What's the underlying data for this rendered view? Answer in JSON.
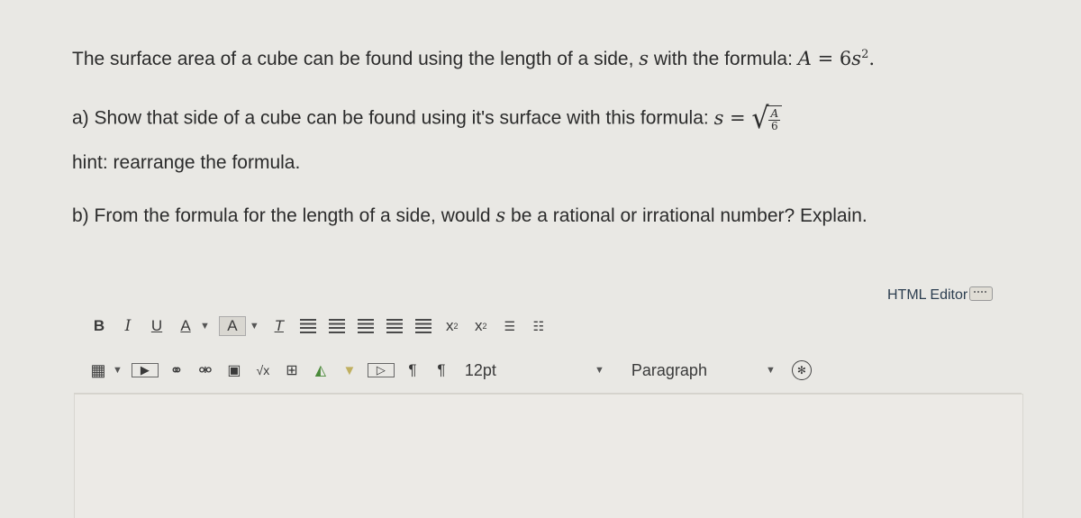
{
  "question": {
    "intro_text": "The surface area of a cube can be found using the length of a side, ",
    "intro_var": "s",
    "intro_text2": " with the formula: ",
    "formula_surface": {
      "lhs": "A",
      "eq": " = ",
      "coef": "6",
      "var": "s",
      "exp": "2",
      "end": "."
    },
    "part_a_text": "a) Show that side of a cube can be found using it's surface with this formula: ",
    "formula_side": {
      "lhs": "s",
      "eq": " = ",
      "num": "A",
      "den": "6"
    },
    "hint": "hint: rearrange the formula.",
    "part_b_pre": "b) From the formula for the length of a side, would ",
    "part_b_var": "s",
    "part_b_post": " be a rational or irrational number? Explain."
  },
  "editor": {
    "html_editor_label": "HTML Editor",
    "toolbar_row1": {
      "bold": "B",
      "italic": "I",
      "underline": "U",
      "font_color": "A",
      "bg_color": "A",
      "clear_format": "T",
      "superscript": "x",
      "superscript_mark": "2",
      "subscript": "x",
      "subscript_mark": "2"
    },
    "toolbar_row2": {
      "pilcrow_ltr": "¶",
      "pilcrow_rtl": "¶",
      "font_size": "12pt",
      "block_format": "Paragraph"
    },
    "icons": [
      "table-icon",
      "media-icon",
      "link-icon",
      "unlink-icon",
      "image-icon",
      "equation-icon",
      "record-icon",
      "google-drive-icon",
      "video-icon",
      "embed-icon",
      "accessibility-icon"
    ]
  }
}
